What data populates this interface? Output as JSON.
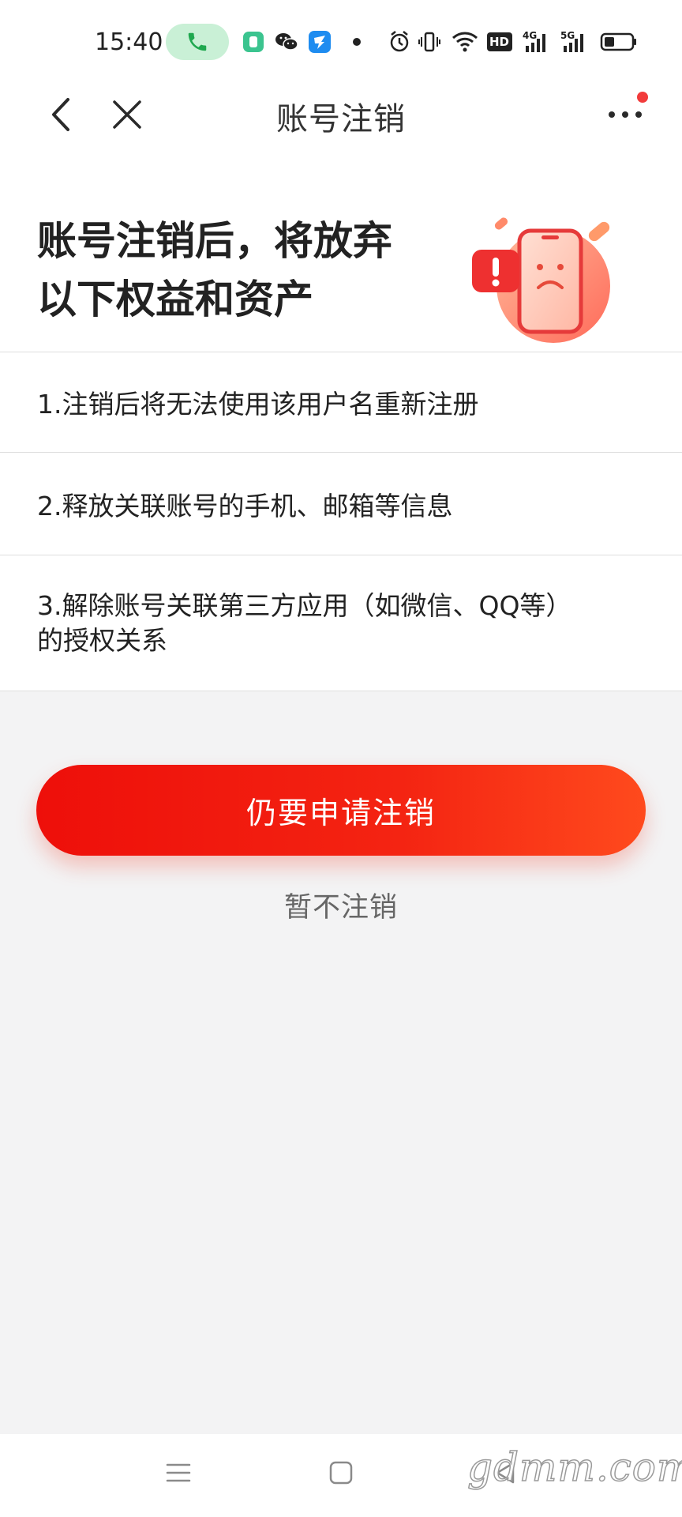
{
  "status_bar": {
    "time": "15:40",
    "icons": [
      "phone-call-icon",
      "app-icon",
      "wechat-icon",
      "dingtalk-icon",
      "dot-icon",
      "alarm-icon",
      "vibrate-icon",
      "wifi-icon",
      "hd-icon",
      "signal-4g-icon",
      "signal-5g-icon",
      "battery-icon"
    ],
    "hd_label": "HD",
    "net_4g": "4G",
    "net_5g": "5G"
  },
  "nav": {
    "title": "账号注销",
    "back_icon": "back-arrow-icon",
    "close_icon": "close-icon",
    "more_icon": "more-icon",
    "badge_color": "#f23b3b"
  },
  "hero": {
    "title_line1": "账号注销后，将放弃",
    "title_line2": "以下权益和资产"
  },
  "items": [
    {
      "text": "1.注销后将无法使用该用户名重新注册"
    },
    {
      "text": "2.释放关联账号的手机、邮箱等信息"
    },
    {
      "text_line1": "3.解除账号关联第三方应用（如微信、QQ等）",
      "text_line2": "的授权关系"
    }
  ],
  "actions": {
    "confirm_label": "仍要申请注销",
    "cancel_label": "暂不注销",
    "accent_color": "#f0140c"
  },
  "system_nav": {
    "icons": [
      "menu-icon",
      "home-icon",
      "back-icon"
    ]
  },
  "watermark": "gdmm.com"
}
